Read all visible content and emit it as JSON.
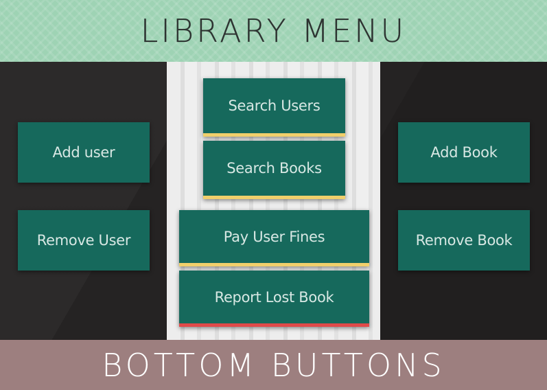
{
  "header": {
    "title": "LIBRARY MENU"
  },
  "left_buttons": {
    "add_user": "Add user",
    "remove_user": "Remove User"
  },
  "center_buttons": {
    "search_users": "Search Users",
    "search_books": "Search Books",
    "pay_user_fines": "Pay User Fines",
    "report_lost_book": "Report Lost Book"
  },
  "right_buttons": {
    "add_book": "Add Book",
    "remove_book": "Remove Book"
  },
  "footer": {
    "title": "BOTTOM BUTTONS"
  },
  "colors": {
    "header_bg": "#9ed3b4",
    "button_bg": "#16695c",
    "accent_yellow": "#f1cf6b",
    "accent_red": "#e04a4a",
    "footer_bg": "#9d7f7f",
    "main_bg": "#252323"
  }
}
